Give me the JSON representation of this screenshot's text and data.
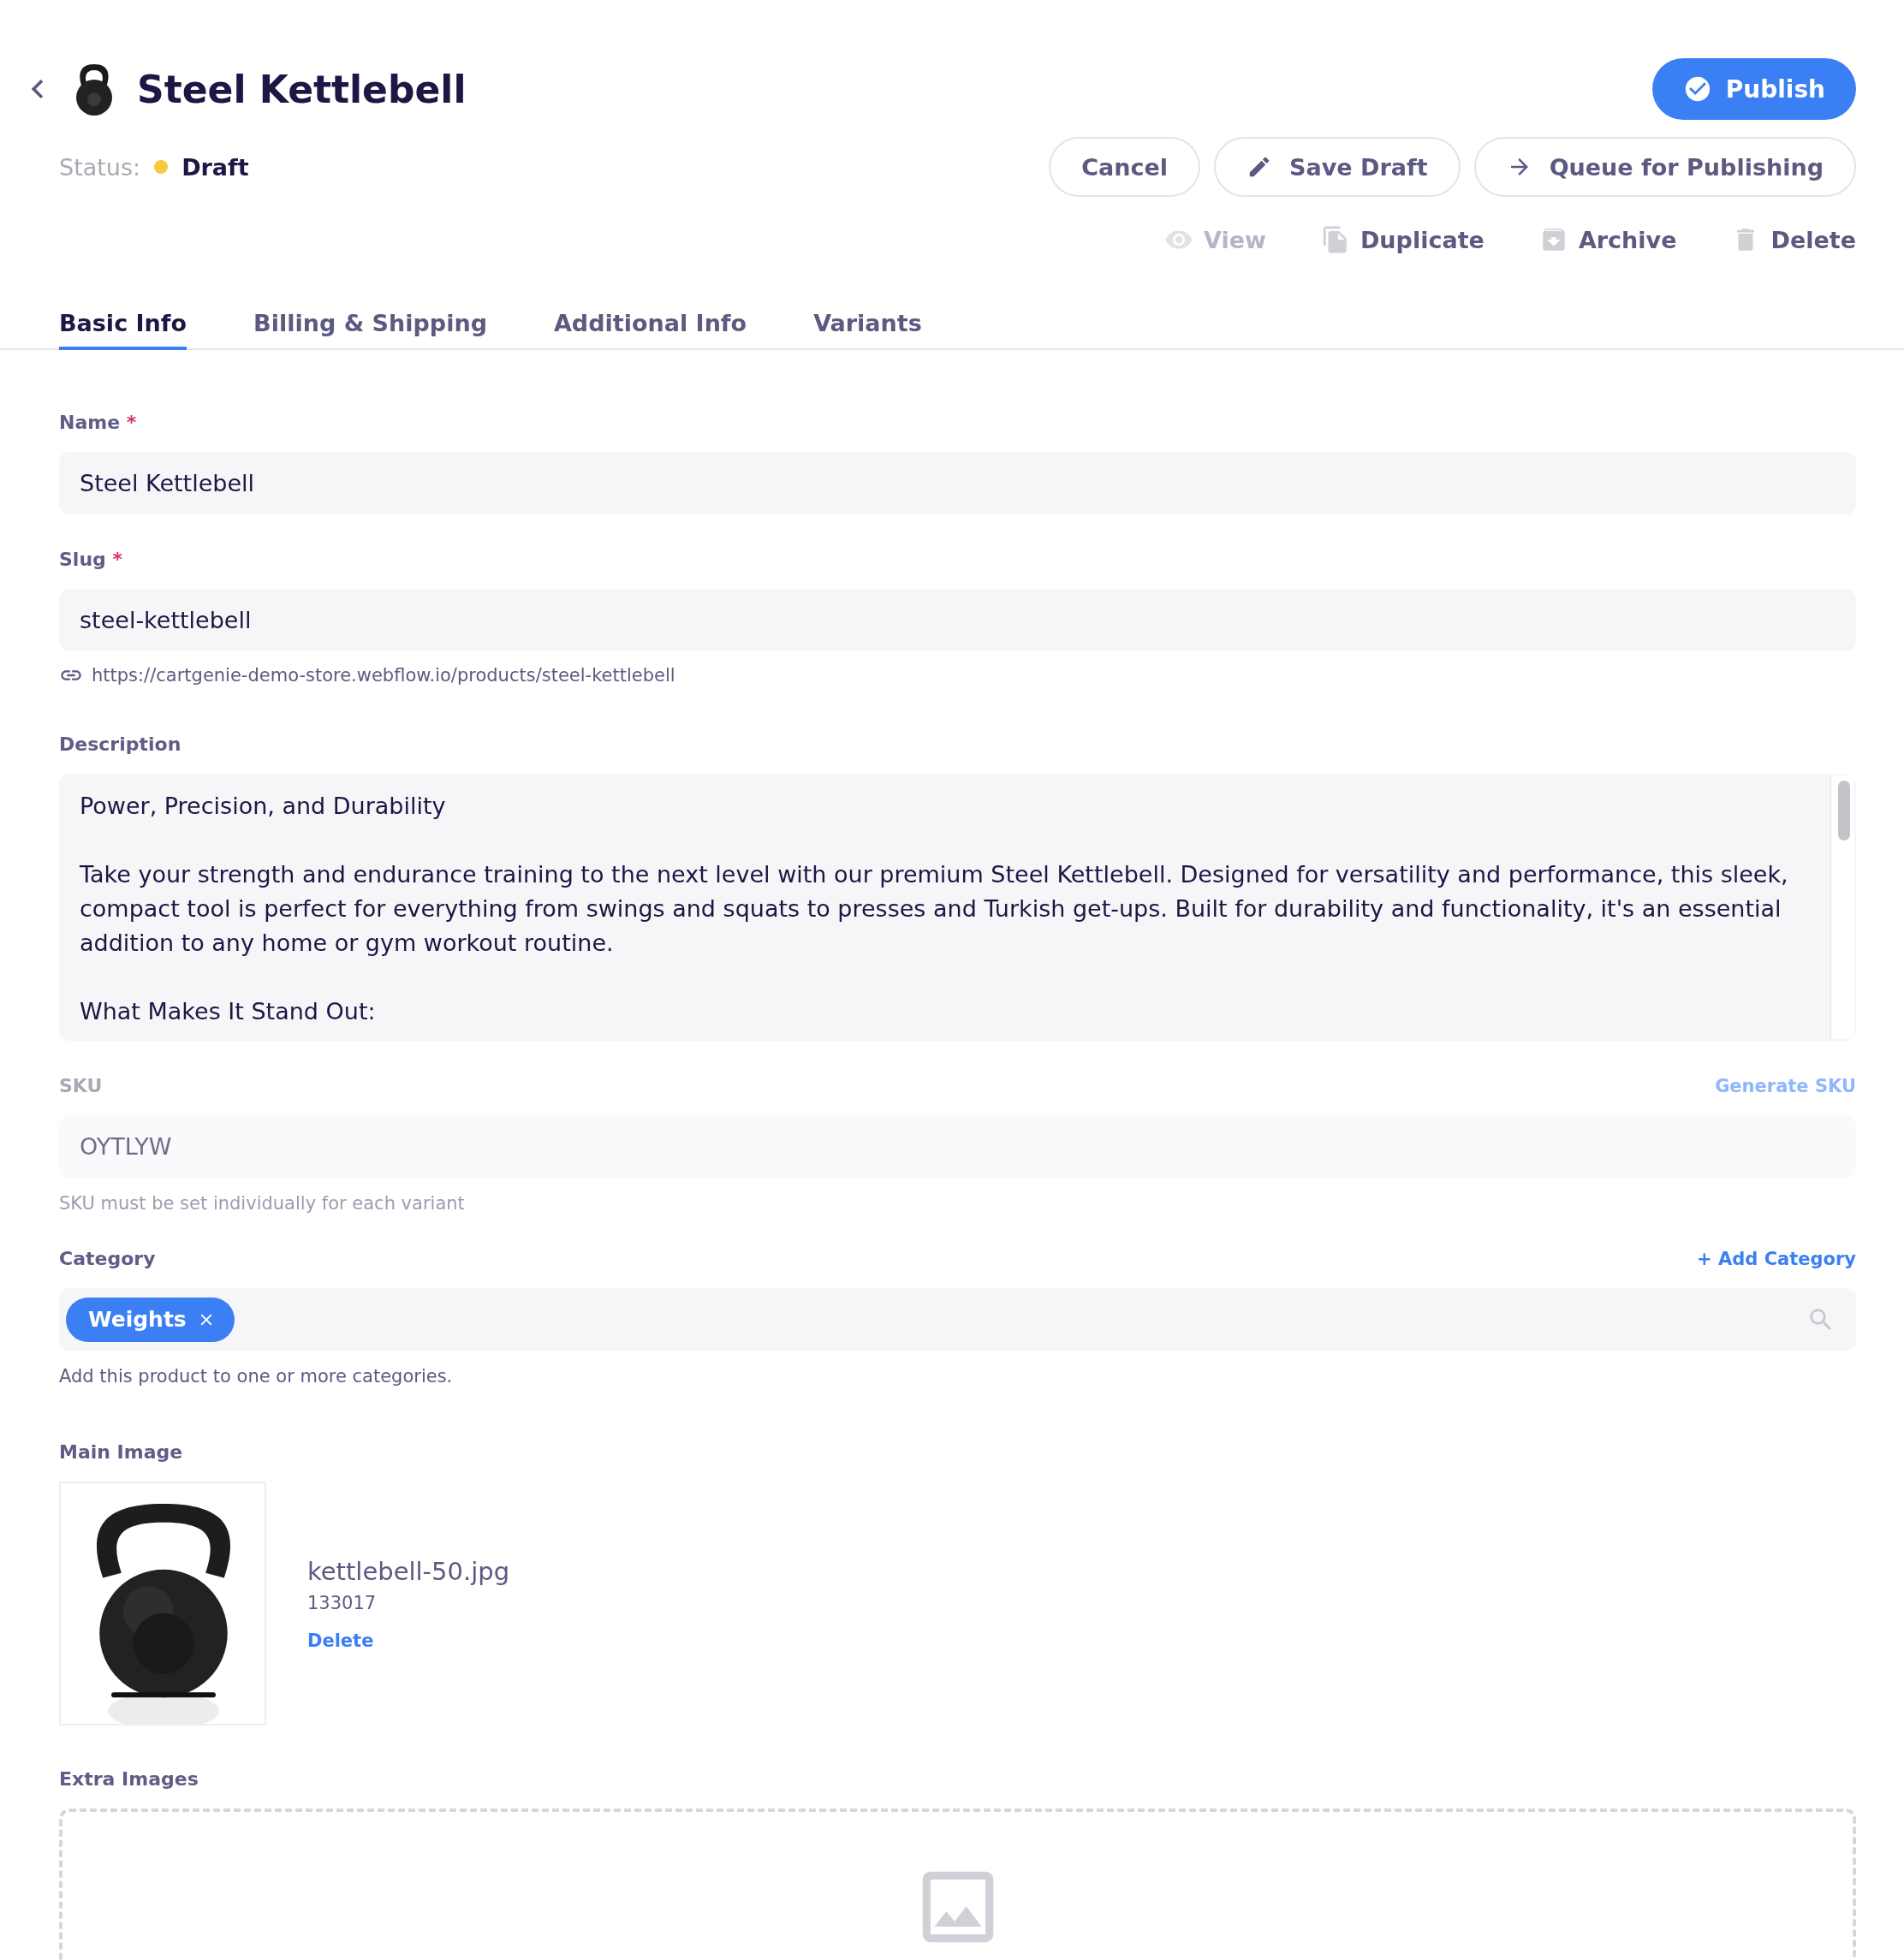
{
  "header": {
    "title": "Steel Kettlebell",
    "status_label": "Status:",
    "status": {
      "text": "Draft",
      "color": "#f7c93e"
    }
  },
  "publish": {
    "label": "Publish"
  },
  "buttons": [
    {
      "label": "Cancel"
    },
    {
      "label": "Save Draft"
    },
    {
      "label": "Queue for Publishing"
    }
  ],
  "actions": [
    {
      "label": "View",
      "disabled": true
    },
    {
      "label": "Duplicate",
      "disabled": false
    },
    {
      "label": "Archive",
      "disabled": false
    },
    {
      "label": "Delete",
      "disabled": false
    }
  ],
  "tabs": [
    {
      "label": "Basic Info",
      "selected": true
    },
    {
      "label": "Billing & Shipping",
      "selected": false
    },
    {
      "label": "Additional Info",
      "selected": false
    },
    {
      "label": "Variants",
      "selected": false
    }
  ],
  "name": {
    "label": "Name",
    "required_mark": "*",
    "value": "Steel Kettlebell"
  },
  "slug": {
    "label": "Slug",
    "required_mark": "*",
    "value": "steel-kettlebell",
    "url": "https://cartgenie-demo-store.webflow.io/products/steel-kettlebell"
  },
  "description": {
    "label": "Description",
    "paragraphs": [
      "Power, Precision, and Durability",
      "Take your strength and endurance training to the next level with our premium Steel Kettlebell. Designed for versatility and performance, this sleek, compact tool is perfect for everything from swings and squats to presses and Turkish get-ups. Built for durability and functionality, it's an essential addition to any home or gym workout routine.",
      "What Makes It Stand Out:"
    ]
  },
  "sku": {
    "label": "SKU",
    "action": "Generate SKU",
    "value": "OYTLYW",
    "hint": "SKU must be set individually for each variant",
    "disabled": true
  },
  "category": {
    "label": "Category",
    "action": "+ Add Category",
    "tags": [
      {
        "label": "Weights"
      }
    ],
    "hint": "Add this product to one or more categories."
  },
  "main_image": {
    "label": "Main Image",
    "file_name": "kettlebell-50.jpg",
    "file_size": "133017",
    "delete": "Delete"
  },
  "extra_images": {
    "label": "Extra Images"
  }
}
